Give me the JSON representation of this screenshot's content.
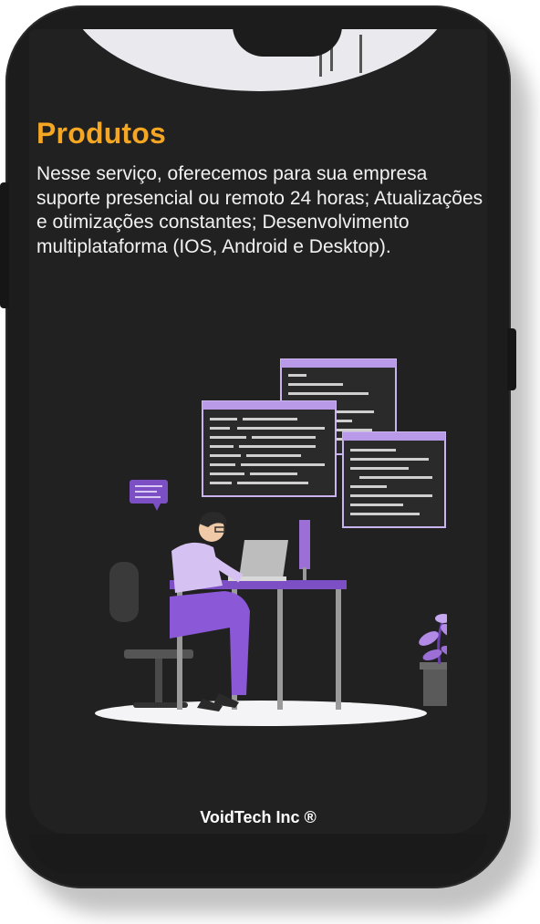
{
  "page": {
    "title": "Produtos",
    "description": "Nesse serviço, oferecemos para sua empresa suporte presencial ou remoto 24 horas; Atualizações e otimizações constantes; Desenvolvimento multiplataforma (IOS, Android e Desktop).",
    "footer": "VoidTech Inc ®"
  },
  "colors": {
    "title": "#f5a623",
    "background": "#212121",
    "accent": "#9b6fd6",
    "text": "#f2f2f2"
  },
  "illustration": {
    "name": "developer-at-desk-illustration",
    "top_illustration": "cropped-circular-illustration"
  }
}
